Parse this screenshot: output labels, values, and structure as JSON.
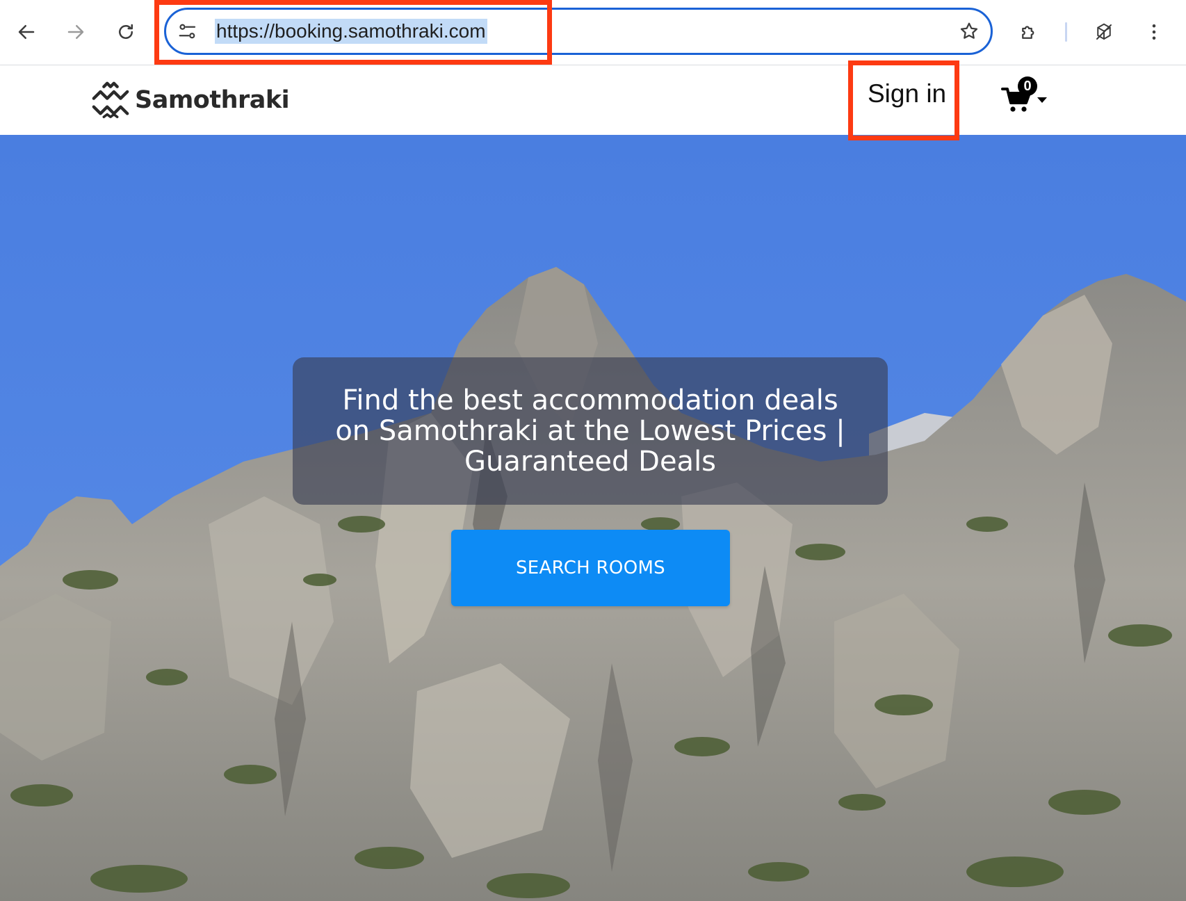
{
  "browser": {
    "url": "https://booking.samothraki.com",
    "icons": {
      "back": "arrow-left-icon",
      "forward": "arrow-right-icon",
      "reload": "reload-icon",
      "site_info": "tune-icon",
      "bookmark": "star-icon",
      "extensions": "puzzle-icon",
      "reading_mode": "cube-slash-icon",
      "menu": "kebab-menu-icon"
    }
  },
  "header": {
    "logo_text": "Samothraki",
    "signin_label": "Sign in",
    "cart_count": "0"
  },
  "hero": {
    "title": "Find the best accommodation deals on Samothraki at the Lowest Prices | Guaranteed Deals",
    "cta_label": "SEARCH ROOMS"
  },
  "colors": {
    "highlight_box": "#fd3a12",
    "omnibox_border": "#1a62d6",
    "cta_button": "#0d8bf5",
    "sky": "#4a7ee0"
  }
}
